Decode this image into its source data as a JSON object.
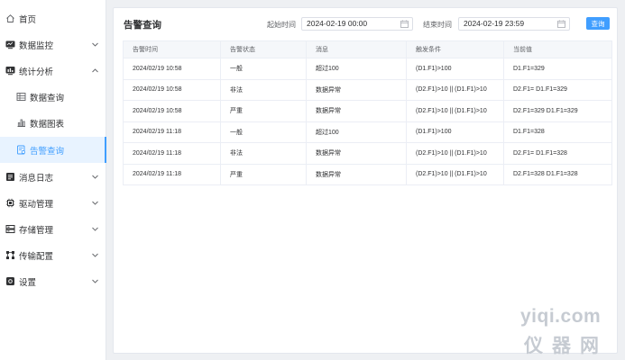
{
  "sidebar": {
    "items": [
      {
        "label": "首页",
        "icon": "home-icon"
      },
      {
        "label": "数据监控",
        "icon": "monitor-icon"
      },
      {
        "label": "统计分析",
        "icon": "chart-analytics-icon"
      },
      {
        "label": "数据查询",
        "icon": "table-icon"
      },
      {
        "label": "数据图表",
        "icon": "bar-chart-icon"
      },
      {
        "label": "告警查询",
        "icon": "alarm-doc-icon"
      },
      {
        "label": "消息日志",
        "icon": "message-log-icon"
      },
      {
        "label": "驱动管理",
        "icon": "chip-icon"
      },
      {
        "label": "存储管理",
        "icon": "storage-icon"
      },
      {
        "label": "传输配置",
        "icon": "transfer-icon"
      },
      {
        "label": "设置",
        "icon": "settings-icon"
      }
    ]
  },
  "main": {
    "title": "告警查询",
    "start_label": "起始时间",
    "start_value": "2024-02-19 00:00",
    "end_label": "结束时间",
    "end_value": "2024-02-19 23:59",
    "query_label": "查询"
  },
  "table": {
    "headers": [
      "告警时间",
      "告警状态",
      "消息",
      "触发条件",
      "当前值"
    ],
    "rows": [
      [
        "2024/02/19 10:58",
        "一般",
        "超过100",
        "(D1.F1)>100",
        "D1.F1=329"
      ],
      [
        "2024/02/19 10:58",
        "非法",
        "数据异常",
        "(D2.F1)>10 || (D1.F1)>10",
        "D2.F1= D1.F1=329"
      ],
      [
        "2024/02/19 10:58",
        "严重",
        "数据异常",
        "(D2.F1)>10 || (D1.F1)>10",
        "D2.F1=329 D1.F1=329"
      ],
      [
        "2024/02/19 11:18",
        "一般",
        "超过100",
        "(D1.F1)>100",
        "D1.F1=328"
      ],
      [
        "2024/02/19 11:18",
        "非法",
        "数据异常",
        "(D2.F1)>10 || (D1.F1)>10",
        "D2.F1= D1.F1=328"
      ],
      [
        "2024/02/19 11:18",
        "严重",
        "数据异常",
        "(D2.F1)>10 || (D1.F1)>10",
        "D2.F1=328 D1.F1=328"
      ]
    ]
  },
  "watermark": {
    "top": "yiqi.com",
    "bottom": "仪器网"
  },
  "colors": {
    "accent": "#409eff",
    "active_bg": "#e8f3ff",
    "page_bg": "#eef0f3"
  }
}
